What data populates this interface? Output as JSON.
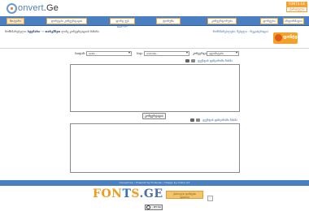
{
  "header": {
    "logo_brand": "onvert",
    "logo_suffix": ".Ge",
    "badge_top": "FONTS.GE",
    "badge_bottom": "ქართული"
  },
  "nav": {
    "items": [
      {
        "label": "მთავარი",
        "active": true
      },
      {
        "label": "ფონტები კონვერტაცია",
        "active": false
      },
      {
        "label": "ფონტ ვებ გვერდი",
        "active": false
      },
      {
        "label": "ფორუმი",
        "active": false
      },
      {
        "label": "კონვერტორები",
        "active": false
      },
      {
        "label": "ფონტები",
        "active": false
      },
      {
        "label": "ინფორმაცია",
        "active": false
      }
    ]
  },
  "info": {
    "left_prefix": "მომხმარებელი:",
    "left_user": "სტუმარი",
    "left_middle": "··· თარგმნეთ",
    "left_rest": "ლინკ კონვერტაციის მიზანი",
    "right": "მომხმარებლები: შესვლა · რეგისტრაცია"
  },
  "ad": {
    "label": "ფონტები"
  },
  "selectors": {
    "from_label": "საიდან:",
    "from_value": "acad...",
    "to_label": "სად:",
    "to_value": "unicode...",
    "font_label": "კონვერტაცია:",
    "font_value": "ავტომატური"
  },
  "top_tools": {
    "link": "ტექსტის ფანჯარაში ჩასმა"
  },
  "convert_button": "კონვერტაცია",
  "bottom_tools": {
    "link": "ტექსტის ფანჯარაში ჩასმა"
  },
  "footer": {
    "text": "Convert.Ge • Powered by Fonts.Ge • Design by Online Art"
  },
  "fonts_logo": {
    "part1": "FON",
    "part2": "T",
    "part3": "S",
    "part4": ".GE"
  },
  "fonts_side": {
    "line1": "ქართული ფონტები",
    "line2": "უფასოდ"
  },
  "cc_badge": {
    "label": "BY SA"
  },
  "colors": {
    "nav_blue": "#4a7fc1",
    "accent_orange": "#f29b1d",
    "link_blue": "#2f5d98"
  }
}
